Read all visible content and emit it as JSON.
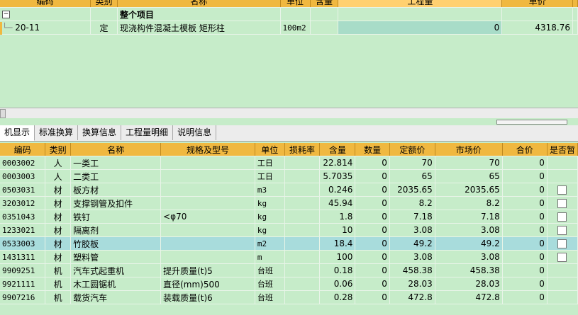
{
  "upper": {
    "headers": [
      "编码",
      "类别",
      "名称",
      "单位",
      "含量",
      "工程量",
      "单价"
    ],
    "group_row": {
      "expander": "−",
      "name": "整个项目"
    },
    "item_row": {
      "code": "20-11",
      "type": "定",
      "name": "现浇构件混凝土模板 矩形柱",
      "unit": "100m2",
      "content": "",
      "quantity": "0",
      "price": "4318.76"
    }
  },
  "tabs": [
    "机显示",
    "标准换算",
    "换算信息",
    "工程量明细",
    "说明信息"
  ],
  "lower": {
    "headers": [
      "编码",
      "类别",
      "名称",
      "规格及型号",
      "单位",
      "损耗率",
      "含量",
      "数量",
      "定额价",
      "市场价",
      "合价",
      "是否暂"
    ],
    "rows": [
      {
        "code": "0003002",
        "type": "人",
        "name": "一类工",
        "spec": "",
        "unit": "工日",
        "loss": "",
        "content": "22.814",
        "qty": "0",
        "quota": "70",
        "market": "70",
        "total": "0",
        "check": false
      },
      {
        "code": "0003003",
        "type": "人",
        "name": "二类工",
        "spec": "",
        "unit": "工日",
        "loss": "",
        "content": "5.7035",
        "qty": "0",
        "quota": "65",
        "market": "65",
        "total": "0",
        "check": false
      },
      {
        "code": "0503031",
        "type": "材",
        "name": "板方材",
        "spec": "",
        "unit": "m3",
        "loss": "",
        "content": "0.246",
        "qty": "0",
        "quota": "2035.65",
        "market": "2035.65",
        "total": "0",
        "check": true
      },
      {
        "code": "3203012",
        "type": "材",
        "name": "支撑钢管及扣件",
        "spec": "",
        "unit": "kg",
        "loss": "",
        "content": "45.94",
        "qty": "0",
        "quota": "8.2",
        "market": "8.2",
        "total": "0",
        "check": true
      },
      {
        "code": "0351043",
        "type": "材",
        "name": "铁钉",
        "spec": "<φ70",
        "unit": "kg",
        "loss": "",
        "content": "1.8",
        "qty": "0",
        "quota": "7.18",
        "market": "7.18",
        "total": "0",
        "check": true
      },
      {
        "code": "1233021",
        "type": "材",
        "name": "隔离剂",
        "spec": "",
        "unit": "kg",
        "loss": "",
        "content": "10",
        "qty": "0",
        "quota": "3.08",
        "market": "3.08",
        "total": "0",
        "check": true
      },
      {
        "code": "0533003",
        "type": "材",
        "name": "竹胶板",
        "spec": "",
        "unit": "m2",
        "loss": "",
        "content": "18.4",
        "qty": "0",
        "quota": "49.2",
        "market": "49.2",
        "total": "0",
        "check": true,
        "selected": true
      },
      {
        "code": "1431311",
        "type": "材",
        "name": "塑料管",
        "spec": "",
        "unit": "m",
        "loss": "",
        "content": "100",
        "qty": "0",
        "quota": "3.08",
        "market": "3.08",
        "total": "0",
        "check": true
      },
      {
        "code": "9909251",
        "type": "机",
        "name": "汽车式起重机",
        "spec": "提升质量(t)5",
        "unit": "台班",
        "loss": "",
        "content": "0.18",
        "qty": "0",
        "quota": "458.38",
        "market": "458.38",
        "total": "0",
        "check": false
      },
      {
        "code": "9921111",
        "type": "机",
        "name": "木工圆锯机",
        "spec": "直径(mm)500",
        "unit": "台班",
        "loss": "",
        "content": "0.06",
        "qty": "0",
        "quota": "28.03",
        "market": "28.03",
        "total": "0",
        "check": false
      },
      {
        "code": "9907216",
        "type": "机",
        "name": "载货汽车",
        "spec": "装载质量(t)6",
        "unit": "台班",
        "loss": "",
        "content": "0.28",
        "qty": "0",
        "quota": "472.8",
        "market": "472.8",
        "total": "0",
        "check": false
      }
    ]
  }
}
